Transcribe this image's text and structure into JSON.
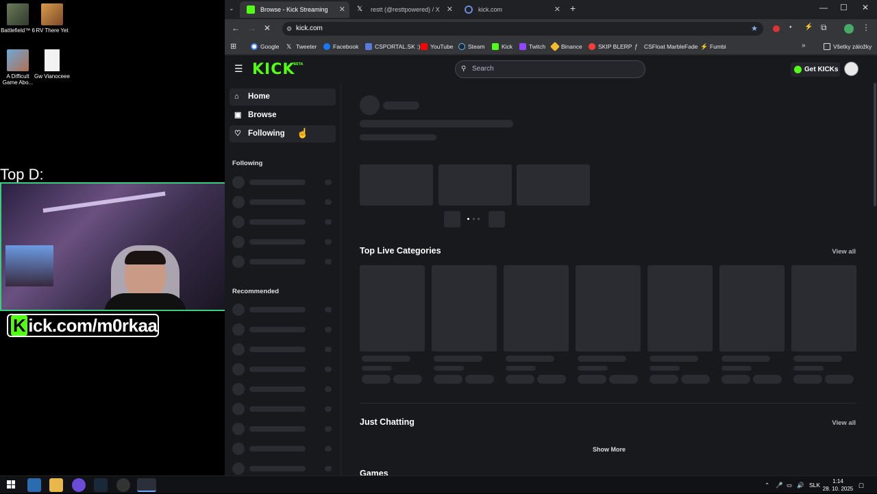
{
  "desktop": {
    "icons": [
      {
        "label": "Battlefield™ 6"
      },
      {
        "label": "RV There Yet"
      },
      {
        "label": "A Difficult Game Abo..."
      },
      {
        "label": "Gw Vianoceee"
      }
    ],
    "overlay_text": "Top D:",
    "channel_tag_k": "K",
    "channel_tag_rest": "ick.com/m0rkaa"
  },
  "browser": {
    "tabs": [
      {
        "label": "Browse - Kick Streaming",
        "active": true
      },
      {
        "label": "restt (@resttpowered) / X",
        "active": false
      },
      {
        "label": "kick.com",
        "active": false
      }
    ],
    "url": "kick.com",
    "bookmarks": [
      "Google",
      "Tweeter",
      "Facebook",
      "CSPORTAL.SK :)",
      "YouTube",
      "Steam",
      "Kick",
      "Twitch",
      "Binance",
      "SKIP BLERP",
      "CSFloat MarbleFade",
      "Fumbi"
    ],
    "all_bookmarks": "Všetky záložky",
    "window_controls": {
      "minimize": "—",
      "maximize": "☐",
      "close": "✕"
    }
  },
  "kick": {
    "logo": "KICK",
    "logo_badge": "BETA",
    "search_placeholder": "Search",
    "get_kicks": "Get KICKs",
    "nav": [
      {
        "label": "Home",
        "icon": "home-icon"
      },
      {
        "label": "Browse",
        "icon": "browse-icon"
      },
      {
        "label": "Following",
        "icon": "heart-icon"
      }
    ],
    "sidebar_following": "Following",
    "sidebar_recommended": "Recommended",
    "top_live_categories": "Top Live Categories",
    "just_chatting": "Just Chatting",
    "games": "Games",
    "view_all": "View all",
    "show_more": "Show More"
  },
  "taskbar": {
    "language": "SLK",
    "time": "1:14",
    "date": "28. 10. 2025"
  },
  "colors": {
    "kick_green": "#53fc18",
    "page_bg": "#18191c",
    "skeleton": "#2a2c31"
  }
}
